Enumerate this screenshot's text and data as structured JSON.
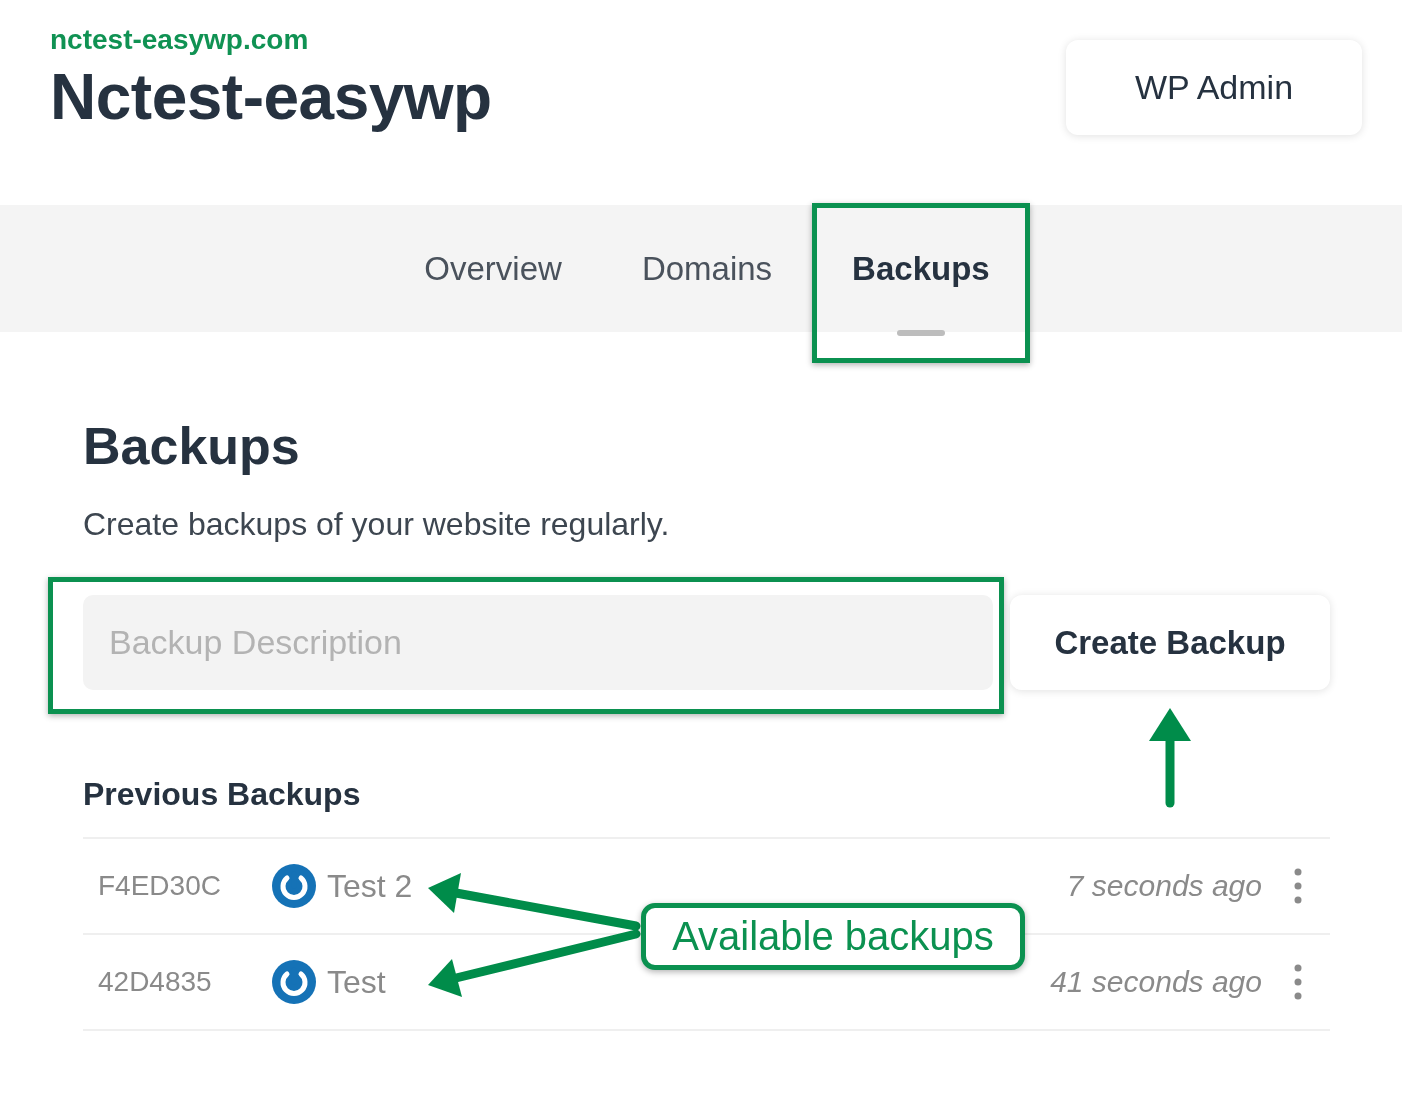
{
  "site": {
    "domain": "nctest-easywp.com",
    "title": "Nctest-easywp",
    "admin_button": "WP Admin"
  },
  "tabs": [
    {
      "label": "Overview",
      "selected": false,
      "highlighted": false
    },
    {
      "label": "Domains",
      "selected": false,
      "highlighted": false
    },
    {
      "label": "Backups",
      "selected": true,
      "highlighted": true
    }
  ],
  "section": {
    "title": "Backups",
    "description": "Create backups of your website regularly."
  },
  "backup_form": {
    "placeholder": "Backup Description",
    "highlighted": true,
    "button": "Create Backup"
  },
  "previous": {
    "title": "Previous Backups",
    "rows": [
      {
        "id": "F4ED30C",
        "name": "Test 2",
        "time": "7 seconds ago"
      },
      {
        "id": "42D4835",
        "name": "Test",
        "time": "41 seconds ago"
      }
    ]
  },
  "annotation": {
    "callout": "Available backups"
  }
}
